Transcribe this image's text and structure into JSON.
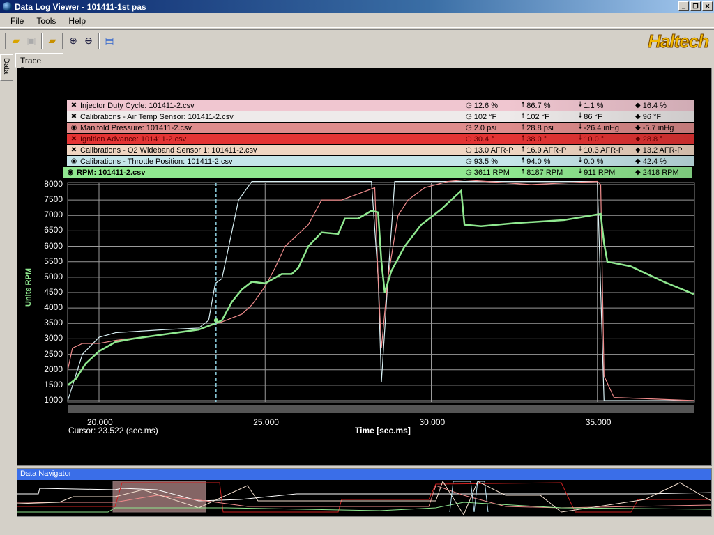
{
  "window": {
    "title": "Data Log Viewer - 101411-1st pas"
  },
  "menu": [
    "File",
    "Tools",
    "Help"
  ],
  "toolbar": {
    "icons": [
      "open-folder-icon",
      "save-icon",
      "import-folder-icon",
      "zoom-in-icon",
      "zoom-out-icon",
      "report-icon"
    ]
  },
  "brand": "Haltech",
  "side_tab": "Data",
  "page_tab": "Trace Page",
  "legend": [
    {
      "name": "Injector Duty Cycle: 101411-2.csv",
      "visible": false,
      "color": "#f0c6d0",
      "current": "12.6 %",
      "max": "86.7 %",
      "min": "1.1 %",
      "avg": "16.4 %"
    },
    {
      "name": "Calibrations - Air Temp Sensor: 101411-2.csv",
      "visible": false,
      "color": "#eeeaea",
      "current": "102 °F",
      "max": "102 °F",
      "min": "86 °F",
      "avg": "96 °F"
    },
    {
      "name": "Manifold Pressure: 101411-2.csv",
      "visible": true,
      "color": "#de8c8c",
      "current": "2.0 psi",
      "max": "28.8 psi",
      "min": "-26.4 inHg",
      "avg": "-5.7 inHg"
    },
    {
      "name": "Ignition Advance: 101411-2.csv",
      "visible": false,
      "color": "#e43434",
      "current": "30.4 °",
      "max": "38.0 °",
      "min": "10.0 °",
      "avg": "28.8 °"
    },
    {
      "name": "Calibrations - O2 Wideband Sensor 1: 101411-2.csv",
      "visible": false,
      "color": "#f0d6c2",
      "current": "13.0 AFR-P",
      "max": "16.9 AFR-P",
      "min": "10.3 AFR-P",
      "avg": "13.2 AFR-P"
    },
    {
      "name": "Calibrations - Throttle Position: 101411-2.csv",
      "visible": true,
      "color": "#c6e6ea",
      "current": "93.5 %",
      "max": "94.0 %",
      "min": "0.0 %",
      "avg": "42.4 %"
    },
    {
      "name": "RPM: 101411-2.csv",
      "visible": true,
      "color": "#90e890",
      "current": "3611 RPM",
      "max": "8187 RPM",
      "min": "911 RPM",
      "avg": "2418 RPM"
    }
  ],
  "chart_data": {
    "type": "line",
    "ylabel": "Units RPM",
    "xlabel": "Time [sec.ms]",
    "ylim": [
      1000,
      8000
    ],
    "xlim": [
      19.06,
      37.9
    ],
    "yticks": [
      "8000",
      "7500",
      "7000",
      "6500",
      "6000",
      "5500",
      "5000",
      "4500",
      "4000",
      "3500",
      "3000",
      "2500",
      "2000",
      "1500",
      "1000"
    ],
    "xticks": [
      "20.000",
      "25.000",
      "30.000",
      "35.000"
    ],
    "cursor_text": "Cursor: 23.522 (sec.ms)",
    "cursor": 23.522,
    "grid": true,
    "series": [
      {
        "name": "Calibrations - Throttle Position",
        "color": "#d8f0f4",
        "x": [
          19.06,
          19.5,
          20,
          20.5,
          22,
          23,
          23.3,
          23.5,
          23.7,
          24.2,
          24.6,
          28.2,
          28.4,
          28.5,
          28.7,
          28.9,
          35.0,
          35.2,
          37.9
        ],
        "y": [
          1000,
          2500,
          3050,
          3200,
          3300,
          3350,
          3600,
          4800,
          4950,
          7500,
          8100,
          8100,
          5000,
          1600,
          5000,
          8100,
          8100,
          1000,
          1000
        ]
      },
      {
        "name": "Manifold Pressure",
        "color": "#f08c8c",
        "x": [
          19.06,
          19.2,
          19.5,
          20,
          20.5,
          22,
          23,
          23.7,
          24.3,
          24.6,
          25,
          25.3,
          25.6,
          25.9,
          26.3,
          26.7,
          27.3,
          27.8,
          28.3,
          28.4,
          28.5,
          28.7,
          29,
          29.3,
          29.8,
          30.5,
          31,
          33,
          35,
          35.1,
          35.2,
          35.5,
          37.9
        ],
        "y": [
          2000,
          2700,
          2850,
          2850,
          2950,
          3150,
          3300,
          3550,
          3800,
          4100,
          4700,
          5300,
          6000,
          6300,
          6700,
          7500,
          7500,
          7700,
          7900,
          5000,
          2700,
          5000,
          7000,
          7500,
          7900,
          8100,
          8150,
          8000,
          8100,
          8000,
          1800,
          1100,
          1000
        ]
      },
      {
        "name": "RPM",
        "color": "#8fe88f",
        "x": [
          19.06,
          19.3,
          19.6,
          20,
          20.5,
          21,
          22,
          23,
          23.5,
          23.7,
          24,
          24.3,
          24.6,
          25,
          25.5,
          25.8,
          26,
          26.3,
          26.7,
          27.2,
          27.4,
          27.8,
          28.2,
          28.4,
          28.5,
          28.6,
          28.8,
          29.2,
          29.7,
          30.3,
          30.9,
          31,
          31.5,
          32.5,
          34,
          35.1,
          35.2,
          35.3,
          36,
          37,
          37.9
        ],
        "y": [
          1500,
          1700,
          2200,
          2600,
          2900,
          3000,
          3150,
          3300,
          3500,
          3600,
          4200,
          4600,
          4850,
          4800,
          5100,
          5100,
          5300,
          6000,
          6450,
          6400,
          6900,
          6900,
          7150,
          7100,
          5500,
          4500,
          5200,
          6000,
          6700,
          7200,
          7800,
          6700,
          6650,
          6750,
          6850,
          7050,
          6100,
          5500,
          5350,
          4850,
          4450
        ]
      }
    ]
  },
  "navigator": {
    "title": "Data Navigator"
  }
}
